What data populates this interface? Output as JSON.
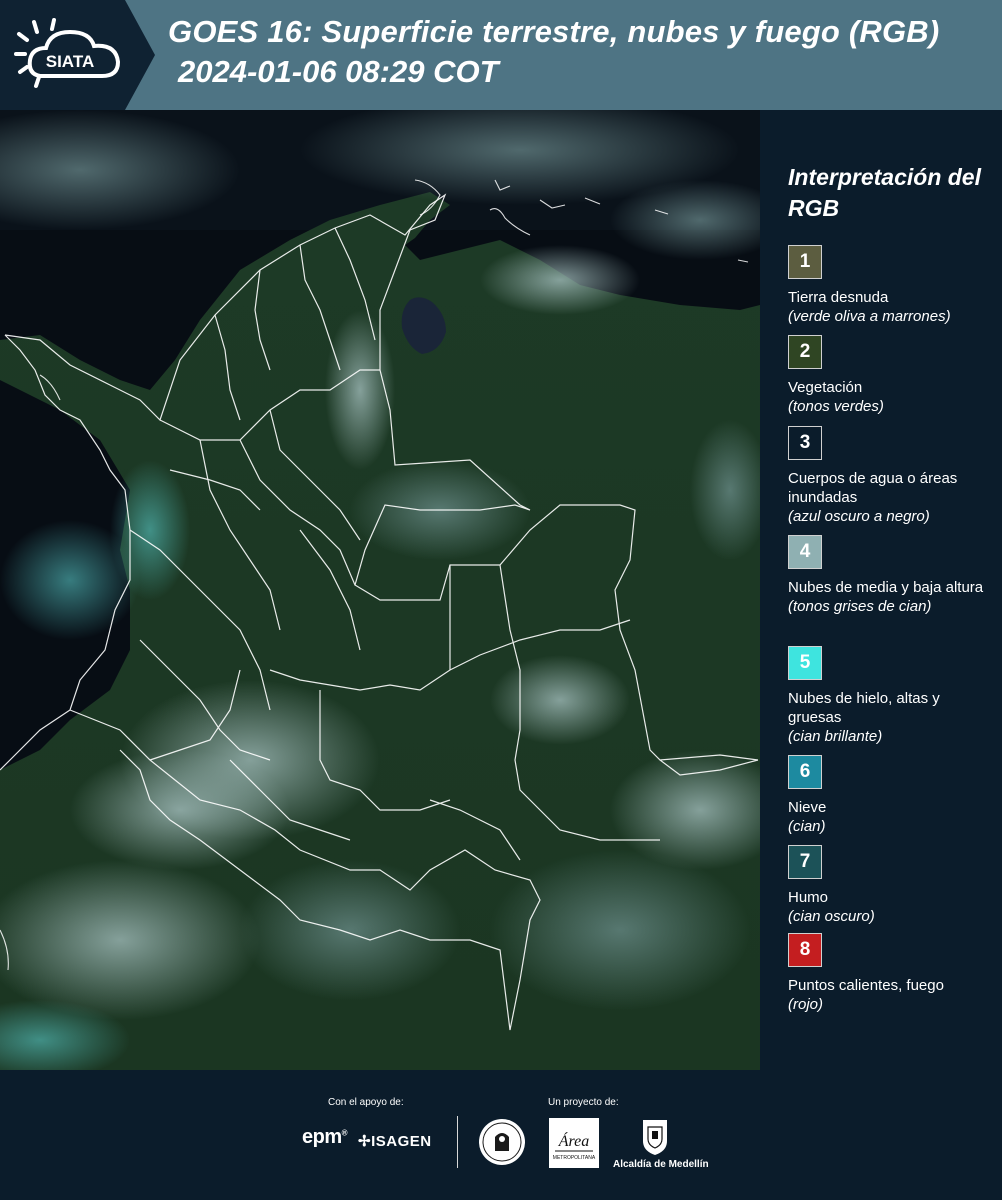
{
  "header": {
    "logo_text": "SIATA",
    "title_line1": "GOES 16: Superficie terrestre, nubes y fuego (RGB)",
    "title_line2": "2024-01-06 08:29 COT"
  },
  "colors": {
    "header_bar": "#4e7484",
    "logo_box": "#0f2232",
    "page_bg": "#0b1c2b",
    "map_land": "#1d3a22",
    "map_ocean": "#070d14",
    "clouds": "#8aa7a6",
    "boundaries": "#ffffff"
  },
  "legend": {
    "title": "Interpretación del RGB",
    "items": [
      {
        "number": "1",
        "label": "Tierra desnuda",
        "sub": "(verde oliva a marrones)",
        "color": "#5c5d40"
      },
      {
        "number": "2",
        "label": "Vegetación",
        "sub": "(tonos verdes)",
        "color": "#2f4523"
      },
      {
        "number": "3",
        "label": "Cuerpos de agua o áreas inundadas",
        "sub": "(azul oscuro a negro)",
        "color": "#0b1c2b"
      },
      {
        "number": "4",
        "label": "Nubes de media y baja altura",
        "sub": "(tonos grises de cian)",
        "color": "#8fb0b2"
      },
      {
        "number": "5",
        "label": "Nubes de hielo, altas y gruesas",
        "sub": "(cian brillante)",
        "color": "#3ee4df"
      },
      {
        "number": "6",
        "label": "Nieve",
        "sub": "(cian)",
        "color": "#1d8aa0"
      },
      {
        "number": "7",
        "label": "Humo",
        "sub": "(cian oscuro)",
        "color": "#1c5258"
      },
      {
        "number": "8",
        "label": "Puntos calientes, fuego",
        "sub": "(rojo)",
        "color": "#c41e20"
      }
    ]
  },
  "footer": {
    "support_label": "Con el apoyo de:",
    "project_label": "Un proyecto de:",
    "epm_text": "epm",
    "isagen_text": "ISAGEN",
    "area_text": "Área",
    "area_sub": "METROPOLITANA",
    "alcaldia_text": "Alcaldía de Medellín"
  }
}
